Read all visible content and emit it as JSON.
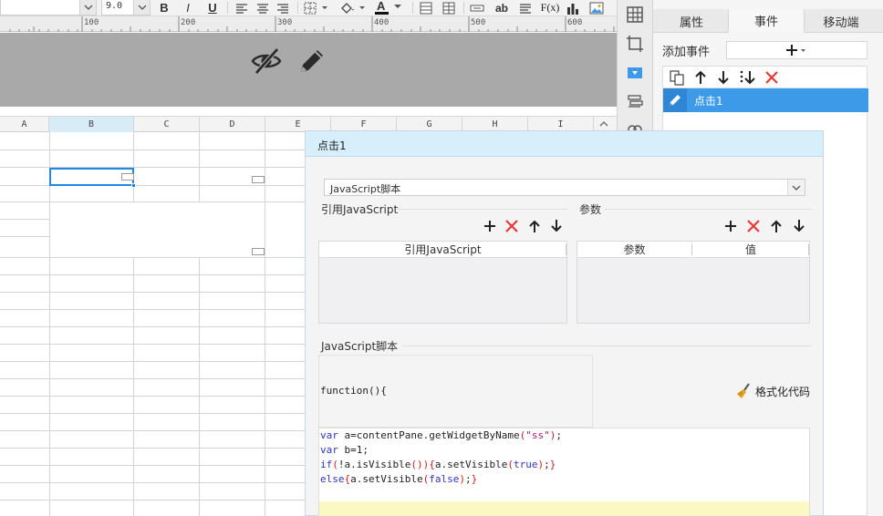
{
  "toolbar": {
    "font_size_value": "9.0",
    "bold_label": "B",
    "italic_label": "I",
    "underline_label": "U",
    "text_ab_label": "ab",
    "fx_label": "F(x)",
    "font_color_label": "A"
  },
  "ruler": {
    "marks": [
      "100",
      "200",
      "300",
      "400",
      "500",
      "600"
    ]
  },
  "canvas": {
    "icons": [
      "eye-slash-icon",
      "pencil-icon"
    ]
  },
  "sheet": {
    "columns": [
      "A",
      "B",
      "C",
      "D",
      "E",
      "F",
      "G",
      "H",
      "I"
    ],
    "selected_column": "B"
  },
  "strip": {
    "icons": [
      "grid-icon",
      "crop-icon",
      "dropdown-widget-icon",
      "list-widget-icon",
      "link-icon"
    ]
  },
  "properties": {
    "tabs": [
      "属性",
      "事件",
      "移动端"
    ],
    "active_tab": "事件",
    "add_event_label": "添加事件",
    "events": [
      {
        "label": "点击1"
      }
    ]
  },
  "dialog": {
    "title": "点击1",
    "type_value": "JavaScript脚本",
    "ref_js_section": "引用JavaScript",
    "params_section": "参数",
    "ref_js_table": {
      "columns": [
        "引用JavaScript"
      ]
    },
    "params_table": {
      "columns": [
        "参数",
        "值"
      ]
    },
    "script_section": "JavaScript脚本",
    "function_header": "function(){",
    "format_button": "格式化代码",
    "code_lines": [
      "var a=contentPane.getWidgetByName(\"ss\");",
      "var b=1;",
      "if(!a.isVisible()){a.setVisible(true);}",
      "else{a.setVisible(false);}"
    ]
  },
  "colors": {
    "accent": "#3d9ae8",
    "dialog_header": "#d6effb",
    "danger": "#e53935",
    "current_line": "#fbf8c4"
  }
}
